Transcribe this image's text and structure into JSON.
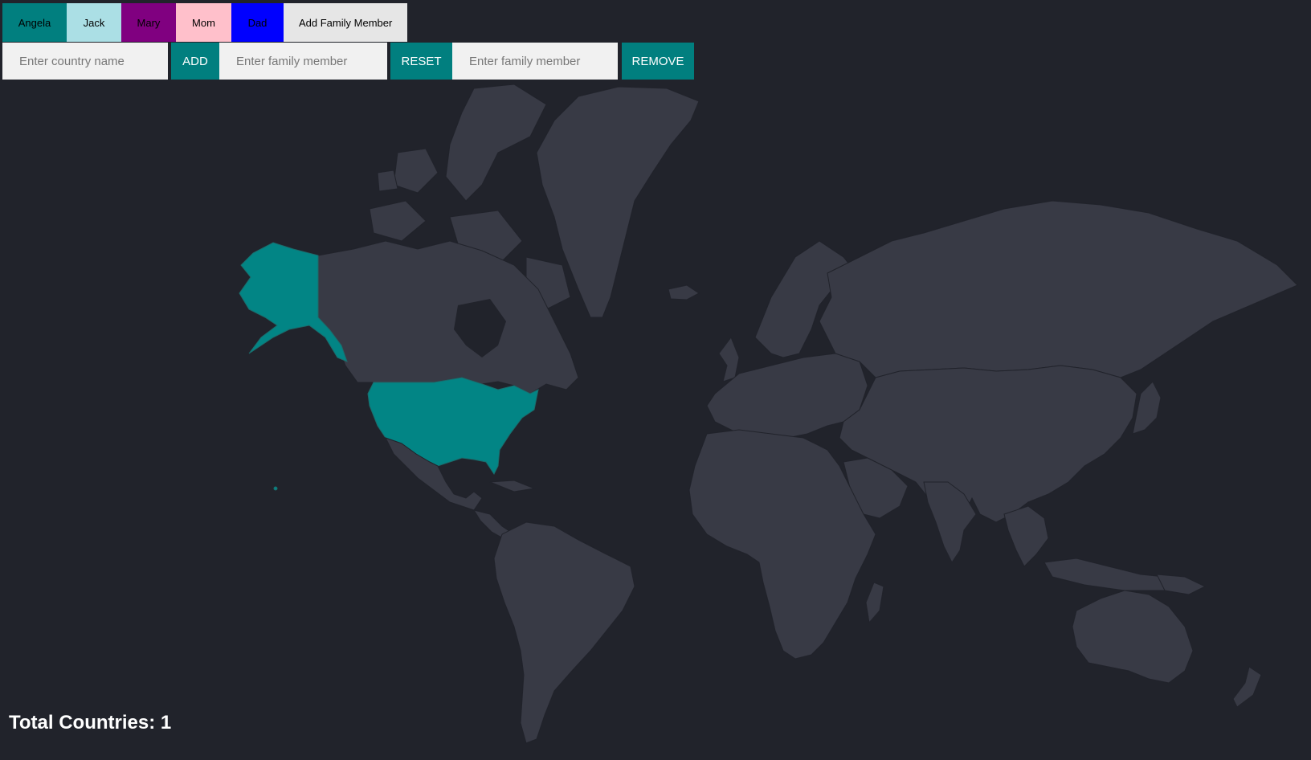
{
  "family_tabs": [
    {
      "label": "Angela",
      "color": "#017f7f"
    },
    {
      "label": "Jack",
      "color": "#abdfe5"
    },
    {
      "label": "Mary",
      "color": "#800080"
    },
    {
      "label": "Mom",
      "color": "#ffc0cb"
    },
    {
      "label": "Dad",
      "color": "#0000ff"
    }
  ],
  "add_family_member_label": "Add Family Member",
  "controls": {
    "country_placeholder": "Enter country name",
    "add_label": "ADD",
    "family_placeholder_1": "Enter family member",
    "reset_label": "RESET",
    "family_placeholder_2": "Enter family member",
    "remove_label": "REMOVE"
  },
  "colors": {
    "background": "#21232b",
    "land": "#383a45",
    "visited": "#028585",
    "accent": "#017f7f"
  },
  "visited_countries": [
    "United States"
  ],
  "total_countries_label": "Total Countries: 1"
}
